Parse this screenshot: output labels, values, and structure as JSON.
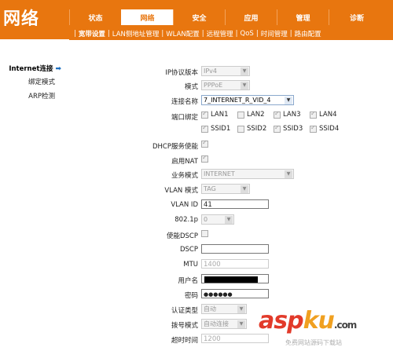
{
  "app": {
    "logo": "网络"
  },
  "tabs": [
    "状态",
    "网络",
    "安全",
    "应用",
    "管理",
    "诊断"
  ],
  "subnav": [
    "宽带设置",
    "LAN侧地址管理",
    "WLAN配置",
    "远程管理",
    "QoS",
    "时间管理",
    "路由配置"
  ],
  "sidebar": {
    "items": [
      {
        "label": "Internet连接",
        "active": true
      },
      {
        "label": "绑定模式"
      },
      {
        "label": "ARP检测"
      }
    ]
  },
  "form": {
    "ip_version": {
      "label": "IP协议版本",
      "value": "IPv4"
    },
    "mode": {
      "label": "模式",
      "value": "PPPoE"
    },
    "conn_name": {
      "label": "连接名称",
      "value": "7_INTERNET_R_VID_4"
    },
    "port_bind": {
      "label": "端口绑定",
      "options": [
        {
          "name": "LAN1",
          "checked": true
        },
        {
          "name": "LAN2",
          "checked": false
        },
        {
          "name": "LAN3",
          "checked": true
        },
        {
          "name": "LAN4",
          "checked": true
        },
        {
          "name": "SSID1",
          "checked": true
        },
        {
          "name": "SSID2",
          "checked": false
        },
        {
          "name": "SSID3",
          "checked": true
        },
        {
          "name": "SSID4",
          "checked": true
        }
      ]
    },
    "dhcp": {
      "label": "DHCP服务使能",
      "checked": true
    },
    "nat": {
      "label": "启用NAT",
      "checked": true
    },
    "service_mode": {
      "label": "业务模式",
      "value": "INTERNET"
    },
    "vlan_mode": {
      "label": "VLAN 模式",
      "value": "TAG"
    },
    "vlan_id": {
      "label": "VLAN ID",
      "value": "41"
    },
    "p8021": {
      "label": "802.1p",
      "value": "0"
    },
    "dscp_enable": {
      "label": "使能DSCP",
      "checked": false
    },
    "dscp": {
      "label": "DSCP",
      "value": ""
    },
    "mtu": {
      "label": "MTU",
      "value": "1400"
    },
    "username": {
      "label": "用户名",
      "value": ""
    },
    "password": {
      "label": "密码",
      "value": "●●●●●●"
    },
    "auth_type": {
      "label": "认证类型",
      "value": "自动"
    },
    "dial_mode": {
      "label": "拨号模式",
      "value": "自动连接"
    },
    "timeout": {
      "label": "超时时间",
      "value": "1200"
    }
  },
  "watermark": {
    "brand": "asp",
    "brand2": "ku",
    "tld": ".com",
    "sub": "免费网站源码下载站"
  }
}
